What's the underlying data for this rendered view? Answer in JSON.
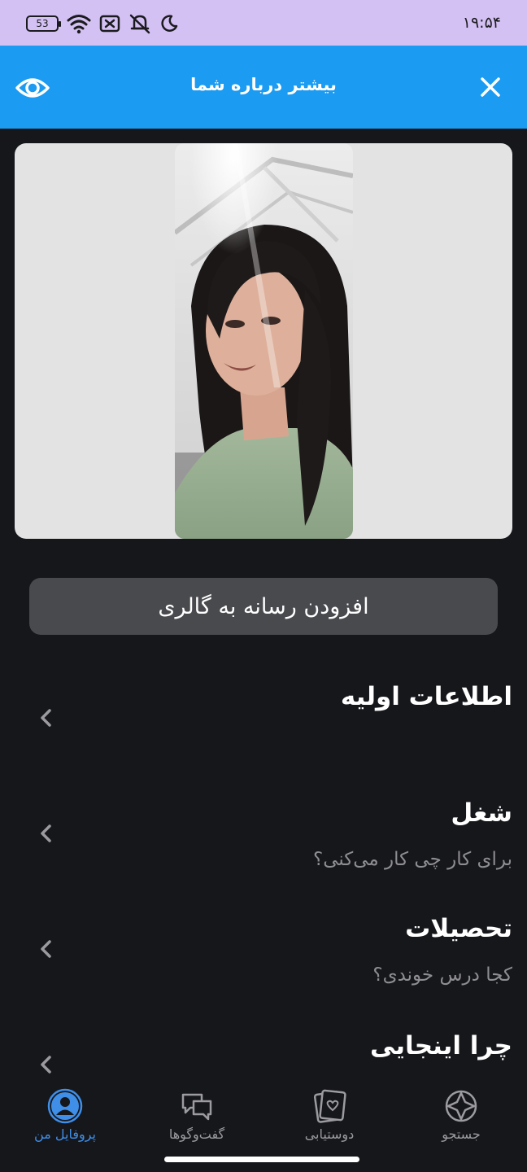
{
  "status_bar": {
    "time": "۱۹:۵۴",
    "battery": "53",
    "icons": [
      "battery-icon",
      "wifi-icon",
      "no-sim-icon",
      "mute-icon",
      "moon-icon"
    ]
  },
  "app_bar": {
    "title": "بیشتر درباره شما",
    "left_icon": "eye-icon",
    "right_icon": "close-icon",
    "color": "#1b9bf1"
  },
  "gallery": {
    "add_media_label": "افزودن رسانه به گالری"
  },
  "sections": [
    {
      "title": "اطلاعات اولیه",
      "subtitle": ""
    },
    {
      "title": "شغل",
      "subtitle": "برای کار چی کار می‌کنی؟"
    },
    {
      "title": "تحصیلات",
      "subtitle": "کجا درس خوندی؟"
    },
    {
      "title": "چرا اینجایی",
      "subtitle": ""
    }
  ],
  "bottom_nav": {
    "items": [
      {
        "label": "جستجو",
        "icon": "compass-icon",
        "active": false
      },
      {
        "label": "دوستیابی",
        "icon": "dating-cards-icon",
        "active": false
      },
      {
        "label": "گفت‌وگوها",
        "icon": "chat-bubbles-icon",
        "active": false
      },
      {
        "label": "پروفایل من",
        "icon": "profile-icon",
        "active": true
      }
    ],
    "active_color": "#3f8ee8"
  }
}
